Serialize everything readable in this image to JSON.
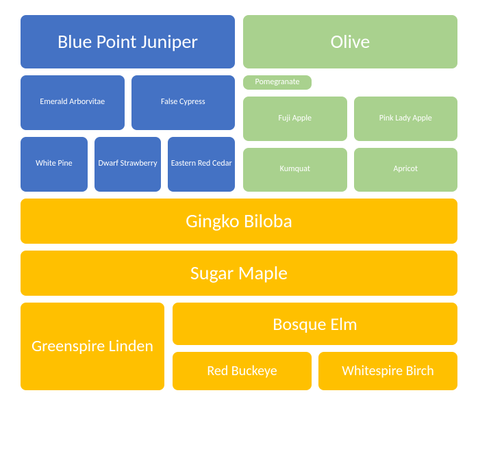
{
  "top": {
    "left": "Blue Point Juniper",
    "right": "Olive"
  },
  "blue": {
    "row1": [
      "Emerald Arborvitae",
      "False Cypress"
    ],
    "row2": [
      "White Pine",
      "Dwarf Strawberry",
      "Eastern Red Cedar"
    ]
  },
  "green": {
    "tall": "Pomegranate",
    "row1": [
      "Fuji Apple",
      "Pink Lady Apple"
    ],
    "row2": [
      "Kumquat",
      "Apricot"
    ]
  },
  "yellow": {
    "bar1": "Gingko Biloba",
    "bar2": "Sugar Maple",
    "linden": "Greenspire Linden",
    "bosque": "Bosque Elm",
    "leaf1": "Red Buckeye",
    "leaf2": "Whitespire Birch"
  }
}
